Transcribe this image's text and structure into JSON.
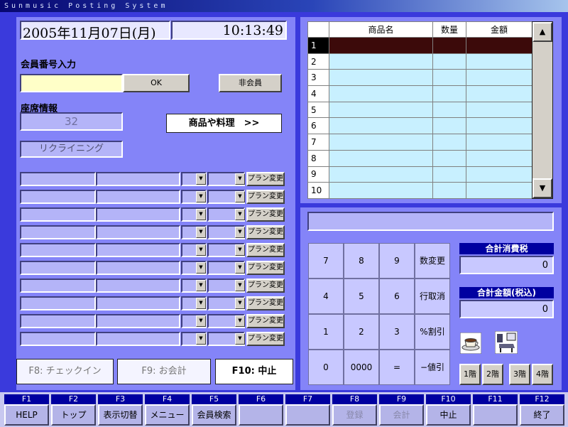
{
  "window": {
    "title": "Sunmusic Posting System"
  },
  "datetime": {
    "date": "2005年11月07日(月)",
    "time": "10:13:49"
  },
  "member": {
    "label": "会員番号入力",
    "value": "",
    "ok_label": "OK",
    "nonmember_label": "非会員"
  },
  "seat": {
    "label": "座席情報",
    "number": "32",
    "type": "リクライニング"
  },
  "product_button": "商品や料理　>>",
  "plan_change_label": "プラン変更",
  "function_buttons": {
    "checkin": "F8: チェックイン",
    "payment": "F9: お会計",
    "stop": "F10: 中止"
  },
  "order_table": {
    "columns": [
      "商品名",
      "数量",
      "金額"
    ],
    "row_numbers": [
      "1",
      "2",
      "3",
      "4",
      "5",
      "6",
      "7",
      "8",
      "9",
      "10"
    ],
    "selected_row": 1
  },
  "scrollbar": {
    "up": "▲",
    "down": "▼"
  },
  "keypad": {
    "keys": [
      [
        "7",
        "8",
        "9",
        "数変更"
      ],
      [
        "4",
        "5",
        "6",
        "行取消"
      ],
      [
        "1",
        "2",
        "3",
        "%割引"
      ],
      [
        "0",
        "0000",
        "=",
        "−値引"
      ]
    ]
  },
  "totals": {
    "tax_label": "合計消費税",
    "tax_value": "0",
    "amount_label": "合計金額(税込)",
    "amount_value": "0"
  },
  "floors": [
    "1階",
    "2階",
    "3階",
    "4階"
  ],
  "fkeys": [
    {
      "key": "F1",
      "label": "HELP",
      "enabled": true
    },
    {
      "key": "F2",
      "label": "トップ",
      "enabled": true
    },
    {
      "key": "F3",
      "label": "表示切替",
      "enabled": true
    },
    {
      "key": "F4",
      "label": "メニュー",
      "enabled": true
    },
    {
      "key": "F5",
      "label": "会員検索",
      "enabled": true
    },
    {
      "key": "F6",
      "label": "",
      "enabled": true
    },
    {
      "key": "F7",
      "label": "",
      "enabled": true
    },
    {
      "key": "F8",
      "label": "登録",
      "enabled": false
    },
    {
      "key": "F9",
      "label": "会計",
      "enabled": false
    },
    {
      "key": "F10",
      "label": "中止",
      "enabled": true
    },
    {
      "key": "F11",
      "label": "",
      "enabled": true
    },
    {
      "key": "F12",
      "label": "終了",
      "enabled": true
    }
  ],
  "colors": {
    "panel": "#8484f8",
    "frame": "#3a3adc",
    "header_blue": "#0000a0",
    "input_yellow": "#ffffc8"
  }
}
